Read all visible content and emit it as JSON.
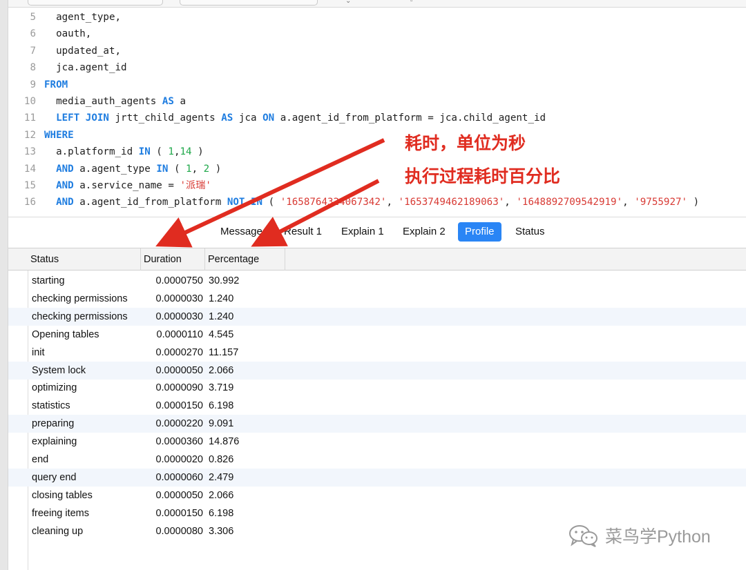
{
  "editor": {
    "lines": [
      {
        "num": "5",
        "tokens": [
          {
            "t": "  agent_type,"
          }
        ]
      },
      {
        "num": "6",
        "tokens": [
          {
            "t": "  oauth,"
          }
        ]
      },
      {
        "num": "7",
        "tokens": [
          {
            "t": "  updated_at,"
          }
        ]
      },
      {
        "num": "8",
        "tokens": [
          {
            "t": "  jca.agent_id"
          }
        ]
      },
      {
        "num": "9",
        "tokens": [
          {
            "t": "FROM",
            "c": "kw"
          }
        ]
      },
      {
        "num": "10",
        "tokens": [
          {
            "t": "  media_auth_agents "
          },
          {
            "t": "AS",
            "c": "kw"
          },
          {
            "t": " a"
          }
        ]
      },
      {
        "num": "11",
        "tokens": [
          {
            "t": "  "
          },
          {
            "t": "LEFT JOIN",
            "c": "kw"
          },
          {
            "t": " jrtt_child_agents "
          },
          {
            "t": "AS",
            "c": "kw"
          },
          {
            "t": " jca "
          },
          {
            "t": "ON",
            "c": "kw"
          },
          {
            "t": " a.agent_id_from_platform = jca.child_agent_id"
          }
        ]
      },
      {
        "num": "12",
        "tokens": [
          {
            "t": "WHERE",
            "c": "kw"
          }
        ]
      },
      {
        "num": "13",
        "tokens": [
          {
            "t": "  a.platform_id "
          },
          {
            "t": "IN",
            "c": "kw"
          },
          {
            "t": " ( "
          },
          {
            "t": "1",
            "c": "num"
          },
          {
            "t": ","
          },
          {
            "t": "14",
            "c": "num"
          },
          {
            "t": " )"
          }
        ]
      },
      {
        "num": "14",
        "tokens": [
          {
            "t": "  "
          },
          {
            "t": "AND",
            "c": "kw"
          },
          {
            "t": " a.agent_type "
          },
          {
            "t": "IN",
            "c": "kw"
          },
          {
            "t": " ( "
          },
          {
            "t": "1",
            "c": "num"
          },
          {
            "t": ", "
          },
          {
            "t": "2",
            "c": "num"
          },
          {
            "t": " )"
          }
        ]
      },
      {
        "num": "15",
        "tokens": [
          {
            "t": "  "
          },
          {
            "t": "AND",
            "c": "kw"
          },
          {
            "t": " a.service_name = "
          },
          {
            "t": "'派瑞'",
            "c": "str"
          }
        ]
      },
      {
        "num": "16",
        "tokens": [
          {
            "t": "  "
          },
          {
            "t": "AND",
            "c": "kw"
          },
          {
            "t": " a.agent_id_from_platform "
          },
          {
            "t": "NOT IN",
            "c": "kw"
          },
          {
            "t": " ( "
          },
          {
            "t": "'1658764324067342'",
            "c": "str"
          },
          {
            "t": ", "
          },
          {
            "t": "'1653749462189063'",
            "c": "str"
          },
          {
            "t": ", "
          },
          {
            "t": "'1648892709542919'",
            "c": "str"
          },
          {
            "t": ", "
          },
          {
            "t": "'9755927'",
            "c": "str"
          },
          {
            "t": " )"
          }
        ]
      }
    ]
  },
  "tabs": [
    {
      "label": "Message",
      "active": false
    },
    {
      "label": "Result 1",
      "active": false
    },
    {
      "label": "Explain 1",
      "active": false
    },
    {
      "label": "Explain 2",
      "active": false
    },
    {
      "label": "Profile",
      "active": true
    },
    {
      "label": "Status",
      "active": false
    }
  ],
  "grid": {
    "columns": [
      "Status",
      "Duration",
      "Percentage"
    ],
    "rows": [
      {
        "status": "starting",
        "duration": "0.0000750",
        "percentage": "30.992"
      },
      {
        "status": "checking permissions",
        "duration": "0.0000030",
        "percentage": "1.240"
      },
      {
        "status": "checking permissions",
        "duration": "0.0000030",
        "percentage": "1.240"
      },
      {
        "status": "Opening tables",
        "duration": "0.0000110",
        "percentage": "4.545"
      },
      {
        "status": "init",
        "duration": "0.0000270",
        "percentage": "11.157"
      },
      {
        "status": "System lock",
        "duration": "0.0000050",
        "percentage": "2.066"
      },
      {
        "status": "optimizing",
        "duration": "0.0000090",
        "percentage": "3.719"
      },
      {
        "status": "statistics",
        "duration": "0.0000150",
        "percentage": "6.198"
      },
      {
        "status": "preparing",
        "duration": "0.0000220",
        "percentage": "9.091"
      },
      {
        "status": "explaining",
        "duration": "0.0000360",
        "percentage": "14.876"
      },
      {
        "status": "end",
        "duration": "0.0000020",
        "percentage": "0.826"
      },
      {
        "status": "query end",
        "duration": "0.0000060",
        "percentage": "2.479"
      },
      {
        "status": "closing tables",
        "duration": "0.0000050",
        "percentage": "2.066"
      },
      {
        "status": "freeing items",
        "duration": "0.0000150",
        "percentage": "6.198"
      },
      {
        "status": "cleaning up",
        "duration": "0.0000080",
        "percentage": "3.306"
      }
    ]
  },
  "annotations": {
    "duration_note": "耗时，单位为秒",
    "percentage_note": "执行过程耗时百分比",
    "color": "#e02c20"
  },
  "watermark": {
    "icon": "wechat-icon",
    "text": "菜鸟学Python"
  },
  "colors": {
    "keyword": "#1f7de0",
    "number": "#1fa84a",
    "string": "#d83a34",
    "active_tab": "#2a85f5",
    "alt_row": "#f2f6fc"
  }
}
